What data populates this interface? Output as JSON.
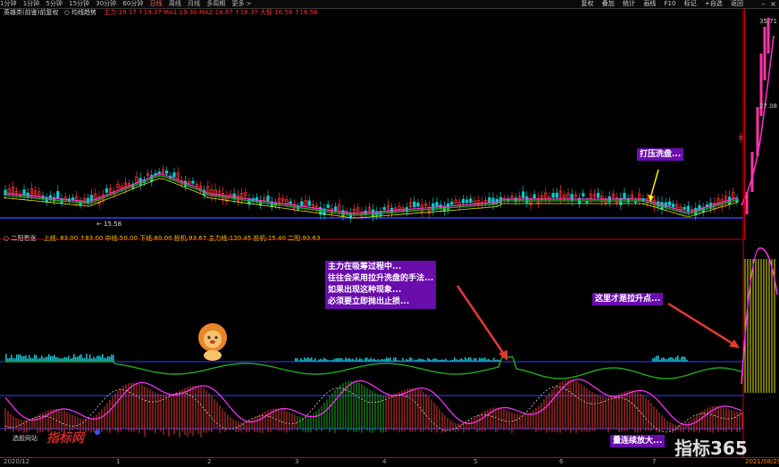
{
  "toolbar": {
    "periods": [
      "1分钟",
      "1分钟",
      "5分钟",
      "15分钟",
      "30分钟",
      "60分钟",
      "日线",
      "周线",
      "月线",
      "多周期",
      "更多 >"
    ],
    "right_items": [
      "复权",
      "叠加",
      "统计",
      "画线",
      "F10",
      "标记",
      "+自选",
      "返回"
    ]
  },
  "legend_main": {
    "title": "英雄类(前鉴)前复权",
    "indicator": "○ 均线趋势",
    "values": "主力:19.37  ↑19.37  MA1:19.30  MA2:18.87  ↑18.37     大智:16.58  ↑16.58"
  },
  "legend_sub": {
    "title": "○ 二阳看涨",
    "values": "上线: 83.00   ↑83.00   中线:50.00   下线:80.00  投机:93.67          主力线:120.45    投机:15.40   二阳:93.63"
  },
  "price_scale": {
    "top": "35.71",
    "mid": "27.08",
    "low": "15.58"
  },
  "low_price_label": "15.58",
  "annotations": {
    "press": "打压洗盘...",
    "absorb": [
      "主力在吸筹过程中...",
      "往往会采用拉升洗盘的手法...",
      "如果出现这种现象...",
      "必须要立即抛出止损..."
    ],
    "lift_point": "这里才是拉升点...",
    "volume": "量连续放大..."
  },
  "dates": [
    {
      "label": "2020/12"
    },
    {
      "label": "1"
    },
    {
      "label": "2"
    },
    {
      "label": "3"
    },
    {
      "label": "4"
    },
    {
      "label": "5"
    },
    {
      "label": "6"
    },
    {
      "label": "7"
    },
    {
      "label": "2021/08/29"
    }
  ],
  "watermark": {
    "left_text": "选股网站",
    "logo": "指标网",
    "brand": "指标365"
  },
  "colors": {
    "up": "#ff3333",
    "down": "#00cccc",
    "ma_green": "#1faa1f",
    "ma_magenta": "#ff33cc",
    "baseline": "#2b44ff",
    "annotation": "#6a0dad"
  }
}
